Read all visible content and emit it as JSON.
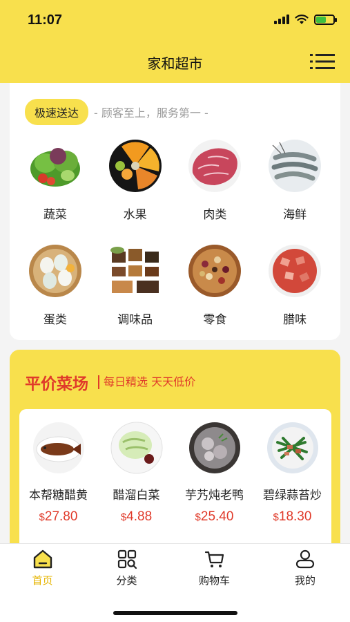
{
  "status_bar": {
    "time": "11:07"
  },
  "header": {
    "title": "家和超市",
    "menu_icon": "menu-list-icon"
  },
  "promo": {
    "badge": "极速送达",
    "slogan": "- 顾客至上，服务第一 -"
  },
  "categories": [
    {
      "label": "蔬菜",
      "icon": "vegetables-image"
    },
    {
      "label": "水果",
      "icon": "fruits-image"
    },
    {
      "label": "肉类",
      "icon": "meat-image"
    },
    {
      "label": "海鲜",
      "icon": "seafood-image"
    },
    {
      "label": "蛋类",
      "icon": "eggs-image"
    },
    {
      "label": "调味品",
      "icon": "seasoning-image"
    },
    {
      "label": "零食",
      "icon": "snacks-image"
    },
    {
      "label": "腊味",
      "icon": "cured-meat-image"
    }
  ],
  "deals": {
    "title": "平价菜场",
    "subtitle": "每日精选 天天低价",
    "items": [
      {
        "name": "本帮糖醋黄",
        "currency": "$",
        "price": "27.80"
      },
      {
        "name": "醋溜白菜",
        "currency": "$",
        "price": "4.88"
      },
      {
        "name": "芋艿炖老鸭",
        "currency": "$",
        "price": "25.40"
      },
      {
        "name": "碧绿蒜苔炒",
        "currency": "$",
        "price": "18.30"
      }
    ]
  },
  "tabbar": [
    {
      "label": "首页",
      "icon": "home-icon",
      "active": true
    },
    {
      "label": "分类",
      "icon": "category-icon",
      "active": false
    },
    {
      "label": "购物车",
      "icon": "cart-icon",
      "active": false
    },
    {
      "label": "我的",
      "icon": "profile-icon",
      "active": false
    }
  ],
  "colors": {
    "brand": "#f8e04d",
    "price": "#e03a2a",
    "active_tab": "#e6b400"
  }
}
